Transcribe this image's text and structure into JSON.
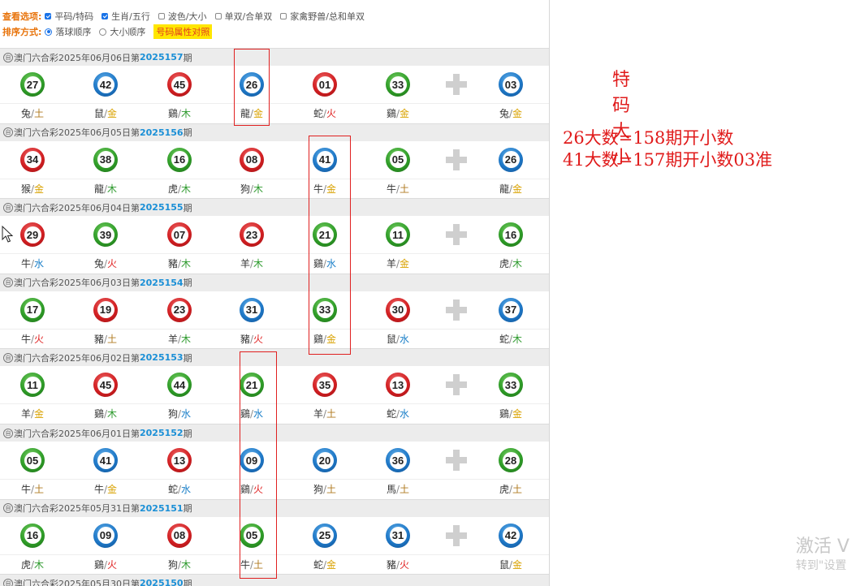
{
  "options": {
    "view_label": "查看选项:",
    "view_items": [
      {
        "label": "平码/特码",
        "checked": true
      },
      {
        "label": "生肖/五行",
        "checked": true
      },
      {
        "label": "波色/大小",
        "checked": false
      },
      {
        "label": "单双/合单双",
        "checked": false
      },
      {
        "label": "家禽野兽/总和单双",
        "checked": false
      }
    ],
    "sort_label": "排序方式:",
    "sort_items": [
      {
        "label": "落球顺序",
        "checked": true
      },
      {
        "label": "大小顺序",
        "checked": false
      }
    ],
    "compare_badge": "号码属性对照"
  },
  "colors": {
    "red": "#d21f22",
    "blue": "#1e78c7",
    "green": "#2f9d28",
    "note": "#e01b1b",
    "issue": "#1a8fd6"
  },
  "draws": [
    {
      "lottery": "澳门六合彩",
      "date": "2025年06月06日",
      "issue_prefix": "第",
      "issue": "2025157",
      "issue_suffix": "期",
      "seal": "自",
      "balls": [
        {
          "num": "27",
          "color": "green",
          "zodiac": "兔",
          "element": "土"
        },
        {
          "num": "42",
          "color": "blue",
          "zodiac": "鼠",
          "element": "金"
        },
        {
          "num": "45",
          "color": "red",
          "zodiac": "鷄",
          "element": "木"
        },
        {
          "num": "26",
          "color": "blue",
          "zodiac": "龍",
          "element": "金"
        },
        {
          "num": "01",
          "color": "red",
          "zodiac": "蛇",
          "element": "火"
        },
        {
          "num": "33",
          "color": "green",
          "zodiac": "鷄",
          "element": "金"
        }
      ],
      "special": {
        "num": "03",
        "color": "blue",
        "zodiac": "兔",
        "element": "金"
      }
    },
    {
      "lottery": "澳门六合彩",
      "date": "2025年06月05日",
      "issue_prefix": "第",
      "issue": "2025156",
      "issue_suffix": "期",
      "seal": "自",
      "balls": [
        {
          "num": "34",
          "color": "red",
          "zodiac": "猴",
          "element": "金"
        },
        {
          "num": "38",
          "color": "green",
          "zodiac": "龍",
          "element": "木"
        },
        {
          "num": "16",
          "color": "green",
          "zodiac": "虎",
          "element": "木"
        },
        {
          "num": "08",
          "color": "red",
          "zodiac": "狗",
          "element": "木"
        },
        {
          "num": "41",
          "color": "blue",
          "zodiac": "牛",
          "element": "金"
        },
        {
          "num": "05",
          "color": "green",
          "zodiac": "牛",
          "element": "土"
        }
      ],
      "special": {
        "num": "26",
        "color": "blue",
        "zodiac": "龍",
        "element": "金"
      }
    },
    {
      "lottery": "澳门六合彩",
      "date": "2025年06月04日",
      "issue_prefix": "第",
      "issue": "2025155",
      "issue_suffix": "期",
      "seal": "自",
      "balls": [
        {
          "num": "29",
          "color": "red",
          "zodiac": "牛",
          "element": "水"
        },
        {
          "num": "39",
          "color": "green",
          "zodiac": "兔",
          "element": "火"
        },
        {
          "num": "07",
          "color": "red",
          "zodiac": "豬",
          "element": "木"
        },
        {
          "num": "23",
          "color": "red",
          "zodiac": "羊",
          "element": "木"
        },
        {
          "num": "21",
          "color": "green",
          "zodiac": "鷄",
          "element": "水"
        },
        {
          "num": "11",
          "color": "green",
          "zodiac": "羊",
          "element": "金"
        }
      ],
      "special": {
        "num": "16",
        "color": "green",
        "zodiac": "虎",
        "element": "木"
      }
    },
    {
      "lottery": "澳门六合彩",
      "date": "2025年06月03日",
      "issue_prefix": "第",
      "issue": "2025154",
      "issue_suffix": "期",
      "seal": "自",
      "balls": [
        {
          "num": "17",
          "color": "green",
          "zodiac": "牛",
          "element": "火"
        },
        {
          "num": "19",
          "color": "red",
          "zodiac": "豬",
          "element": "土"
        },
        {
          "num": "23",
          "color": "red",
          "zodiac": "羊",
          "element": "木"
        },
        {
          "num": "31",
          "color": "blue",
          "zodiac": "豬",
          "element": "火"
        },
        {
          "num": "33",
          "color": "green",
          "zodiac": "鷄",
          "element": "金"
        },
        {
          "num": "30",
          "color": "red",
          "zodiac": "鼠",
          "element": "水"
        }
      ],
      "special": {
        "num": "37",
        "color": "blue",
        "zodiac": "蛇",
        "element": "木"
      }
    },
    {
      "lottery": "澳门六合彩",
      "date": "2025年06月02日",
      "issue_prefix": "第",
      "issue": "2025153",
      "issue_suffix": "期",
      "seal": "自",
      "balls": [
        {
          "num": "11",
          "color": "green",
          "zodiac": "羊",
          "element": "金"
        },
        {
          "num": "45",
          "color": "red",
          "zodiac": "鷄",
          "element": "木"
        },
        {
          "num": "44",
          "color": "green",
          "zodiac": "狗",
          "element": "水"
        },
        {
          "num": "21",
          "color": "green",
          "zodiac": "鷄",
          "element": "水"
        },
        {
          "num": "35",
          "color": "red",
          "zodiac": "羊",
          "element": "土"
        },
        {
          "num": "13",
          "color": "red",
          "zodiac": "蛇",
          "element": "水"
        }
      ],
      "special": {
        "num": "33",
        "color": "green",
        "zodiac": "鷄",
        "element": "金"
      }
    },
    {
      "lottery": "澳门六合彩",
      "date": "2025年06月01日",
      "issue_prefix": "第",
      "issue": "2025152",
      "issue_suffix": "期",
      "seal": "自",
      "balls": [
        {
          "num": "05",
          "color": "green",
          "zodiac": "牛",
          "element": "土"
        },
        {
          "num": "41",
          "color": "blue",
          "zodiac": "牛",
          "element": "金"
        },
        {
          "num": "13",
          "color": "red",
          "zodiac": "蛇",
          "element": "水"
        },
        {
          "num": "09",
          "color": "blue",
          "zodiac": "鷄",
          "element": "火"
        },
        {
          "num": "20",
          "color": "blue",
          "zodiac": "狗",
          "element": "土"
        },
        {
          "num": "36",
          "color": "blue",
          "zodiac": "馬",
          "element": "土"
        }
      ],
      "special": {
        "num": "28",
        "color": "green",
        "zodiac": "虎",
        "element": "土"
      }
    },
    {
      "lottery": "澳门六合彩",
      "date": "2025年05月31日",
      "issue_prefix": "第",
      "issue": "2025151",
      "issue_suffix": "期",
      "seal": "自",
      "balls": [
        {
          "num": "16",
          "color": "green",
          "zodiac": "虎",
          "element": "木"
        },
        {
          "num": "09",
          "color": "blue",
          "zodiac": "鷄",
          "element": "火"
        },
        {
          "num": "08",
          "color": "red",
          "zodiac": "狗",
          "element": "木"
        },
        {
          "num": "05",
          "color": "green",
          "zodiac": "牛",
          "element": "土"
        },
        {
          "num": "25",
          "color": "blue",
          "zodiac": "蛇",
          "element": "金"
        },
        {
          "num": "31",
          "color": "blue",
          "zodiac": "豬",
          "element": "火"
        }
      ],
      "special": {
        "num": "42",
        "color": "blue",
        "zodiac": "鼠",
        "element": "金"
      }
    },
    {
      "lottery": "澳门六合彩",
      "date": "2025年05月30日",
      "issue_prefix": "第",
      "issue": "2025150",
      "issue_suffix": "期",
      "seal": "自",
      "balls": [],
      "special": null
    }
  ],
  "annotation": {
    "title": "特码大小",
    "lines": [
      "26大数=158期开小数",
      "41大数=157期开小数03准"
    ]
  },
  "watermark": {
    "line1": "激活 V",
    "line2": "转到\"设置"
  }
}
